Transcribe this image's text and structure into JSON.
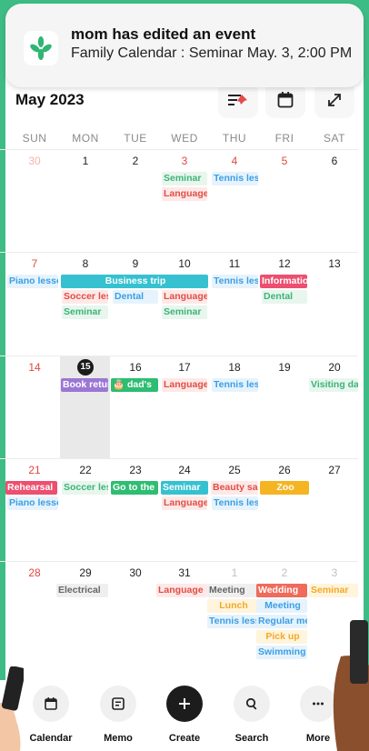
{
  "notification": {
    "title": "mom has edited an event",
    "body": "Family Calendar : Seminar May. 3, 2:00 PM"
  },
  "header": {
    "month": "May 2023"
  },
  "weekdays": [
    "SUN",
    "MON",
    "TUE",
    "WED",
    "THU",
    "FRI",
    "SAT"
  ],
  "weeks": [
    {
      "days": [
        "30",
        "1",
        "2",
        "3",
        "4",
        "5",
        "6"
      ]
    },
    {
      "days": [
        "7",
        "8",
        "9",
        "10",
        "11",
        "12",
        "13"
      ]
    },
    {
      "days": [
        "14",
        "15",
        "16",
        "17",
        "18",
        "19",
        "20"
      ]
    },
    {
      "days": [
        "21",
        "22",
        "23",
        "24",
        "25",
        "26",
        "27"
      ]
    },
    {
      "days": [
        "28",
        "29",
        "30",
        "31",
        "1",
        "2",
        "3"
      ]
    }
  ],
  "events": {
    "w1": {
      "seminar": "Seminar",
      "language": "Language",
      "tennis": "Tennis lesson"
    },
    "w2": {
      "piano": "Piano lesson",
      "business_trip": "Business trip",
      "tennis": "Tennis lesson",
      "information": "Information",
      "soccer": "Soccer lesson",
      "dental_tue": "Dental",
      "language": "Language",
      "dental_fri": "Dental",
      "seminar_mon": "Seminar",
      "seminar_wed": "Seminar"
    },
    "w3": {
      "book": "Book return",
      "dad": "🎂 dad's",
      "language": "Language",
      "tennis": "Tennis lesson",
      "visiting": "Visiting day"
    },
    "w4": {
      "rehearsal": "Rehearsal",
      "soccer": "Soccer lesson",
      "goto": "Go to the",
      "seminar": "Seminar",
      "beauty": "Beauty salon",
      "zoo": "Zoo",
      "piano": "Piano lesson",
      "language": "Language",
      "tennis": "Tennis lesson"
    },
    "w5": {
      "electrical": "Electrical",
      "language": "Language",
      "meeting_thu": "Meeting",
      "wedding": "Wedding",
      "seminar": "Seminar",
      "lunch": "Lunch",
      "meeting_fri": "Meeting",
      "tennis": "Tennis lesson",
      "regular": "Regular meeting",
      "pickup": "Pick up",
      "swimming": "Swimming"
    }
  },
  "nav": {
    "calendar": "Calendar",
    "memo": "Memo",
    "create": "Create",
    "search": "Search",
    "more": "More"
  }
}
